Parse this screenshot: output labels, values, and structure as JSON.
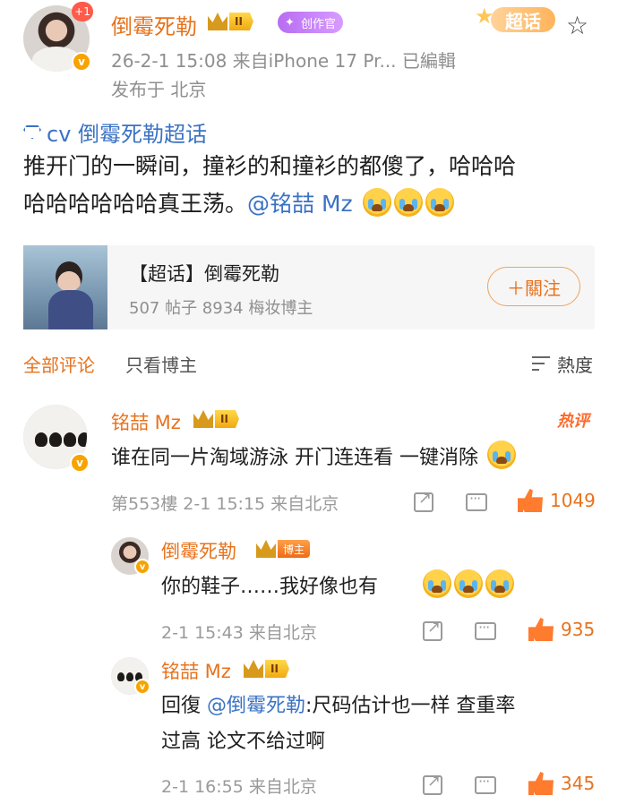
{
  "post": {
    "author": "倒霉死勒",
    "level": "II",
    "creator_badge": "创作官",
    "avatar_notification": "+1",
    "meta_line": "26-2-1 15:08  来自iPhone 17 Pr...  已編輯",
    "location_line": "发布于 北京",
    "super_topic_badge": "超话",
    "topic_link": "cv 倒霉死勒超话",
    "text_line1": "推开门的一瞬间，撞衫的和撞衫的都傻了，哈哈哈",
    "text_line2": "哈哈哈哈哈哈真王荡。",
    "mention": "@铭喆 Mz"
  },
  "card": {
    "title": "【超话】倒霉死勒",
    "stats": "507 帖子  8934 梅妆博主",
    "follow_label": "＋關注"
  },
  "tabs": {
    "all_comments": "全部评论",
    "blogger_only": "只看博主",
    "sort_label": "熱度"
  },
  "comments": [
    {
      "author": "铭喆 Mz",
      "level": "II",
      "hot_tag": "热评",
      "text": "谁在同一片淘域游泳  开门连连看  一键消除",
      "meta": "第553樓  2-1 15:15  来自北京",
      "likes": "1049"
    },
    {
      "author": "倒霉死勒",
      "badge": "博主",
      "text": "你的鞋子……我好像也有",
      "meta": "2-1 15:43  来自北京",
      "likes": "935"
    },
    {
      "author": "铭喆 Mz",
      "level": "II",
      "text_prefix": "回復",
      "text_mention": "@倒霉死勒",
      "text_line1": ":尺码估计也一样 查重率",
      "text_line2": "过高 论文不给过啊",
      "meta": "2-1 16:55  来自北京",
      "likes": "345"
    }
  ],
  "colors": {
    "accent_orange": "#e8721c",
    "link_blue": "#3a72c4",
    "like_orange": "#ff7b2e"
  }
}
